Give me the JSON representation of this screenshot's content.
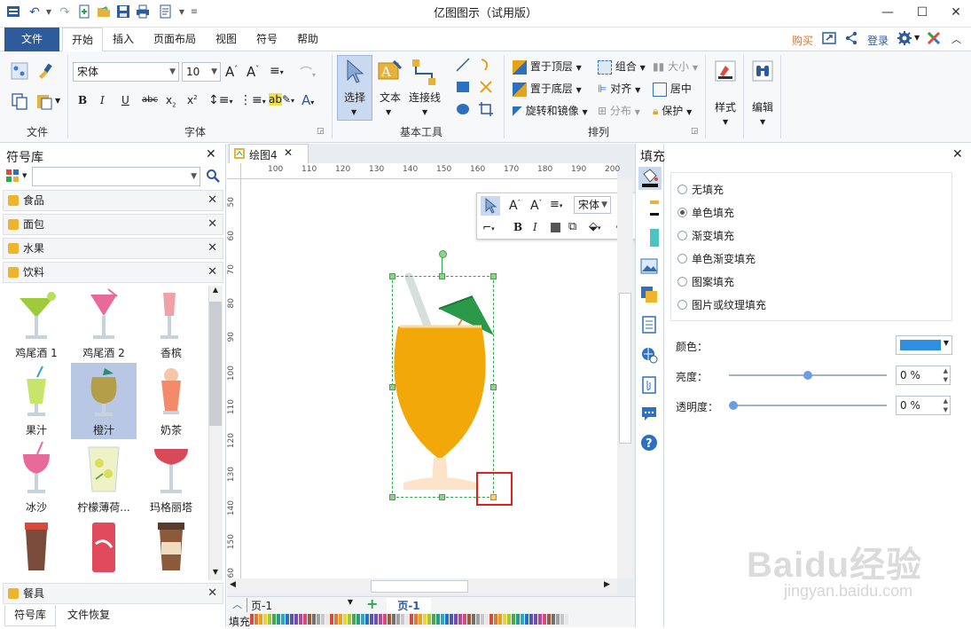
{
  "window": {
    "title": "亿图图示（试用版）"
  },
  "tabs": [
    {
      "label": "文件"
    },
    {
      "label": "开始"
    },
    {
      "label": "插入"
    },
    {
      "label": "页面布局"
    },
    {
      "label": "视图"
    },
    {
      "label": "符号"
    },
    {
      "label": "帮助"
    }
  ],
  "account": {
    "buy": "购买",
    "login": "登录"
  },
  "ribbon": {
    "groups": {
      "file": "文件",
      "font": "字体",
      "basic_tools": "基本工具",
      "arrange": "排列"
    },
    "font_name": "宋体",
    "font_size": "10",
    "select": "选择",
    "text": "文本",
    "connector": "连接线",
    "bring_front": "置于顶层",
    "send_back": "置于底层",
    "rotate_mirror": "旋转和镜像",
    "group": "组合",
    "align": "对齐",
    "distribute": "分布",
    "size": "大小",
    "center": "居中",
    "protect": "保护",
    "style": "样式",
    "edit": "编辑"
  },
  "library": {
    "title": "符号库",
    "categories": [
      "食品",
      "面包",
      "水果",
      "饮料"
    ],
    "bottom_category": "餐具",
    "symbols": [
      {
        "label": "鸡尾酒 1"
      },
      {
        "label": "鸡尾酒 2"
      },
      {
        "label": "香槟"
      },
      {
        "label": "果汁"
      },
      {
        "label": "橙汁"
      },
      {
        "label": "奶茶"
      },
      {
        "label": "冰沙"
      },
      {
        "label": "柠檬薄荷..."
      },
      {
        "label": "玛格丽塔"
      },
      {
        "label": ""
      },
      {
        "label": ""
      },
      {
        "label": ""
      }
    ],
    "tabs": [
      "符号库",
      "文件恢复"
    ]
  },
  "document": {
    "tab": "绘图4"
  },
  "ruler": {
    "top": [
      "100",
      "110",
      "120",
      "130",
      "140",
      "150",
      "160",
      "170",
      "180",
      "190",
      "200"
    ],
    "left": [
      "50",
      "60",
      "70",
      "80",
      "90",
      "100",
      "110",
      "120",
      "130",
      "140",
      "150",
      "160"
    ]
  },
  "floating_toolbar": {
    "font": "宋体"
  },
  "status": {
    "page_select": "页-1",
    "page_tab": "页-1",
    "fill_label": "填充"
  },
  "fill_panel": {
    "title": "填充",
    "options": [
      "无填充",
      "单色填充",
      "渐变填充",
      "单色渐变填充",
      "图案填充",
      "图片或纹理填充"
    ],
    "selected": "单色填充",
    "color_label": "颜色：",
    "color_value": "#2e8fdf",
    "brightness_label": "亮度：",
    "brightness_value": "0 %",
    "brightness_level": 0.5,
    "transparency_label": "透明度：",
    "transparency_value": "0 %",
    "transparency_level": 0
  },
  "watermark": {
    "brand": "Baidu经验",
    "url": "jingyan.baidu.com"
  }
}
